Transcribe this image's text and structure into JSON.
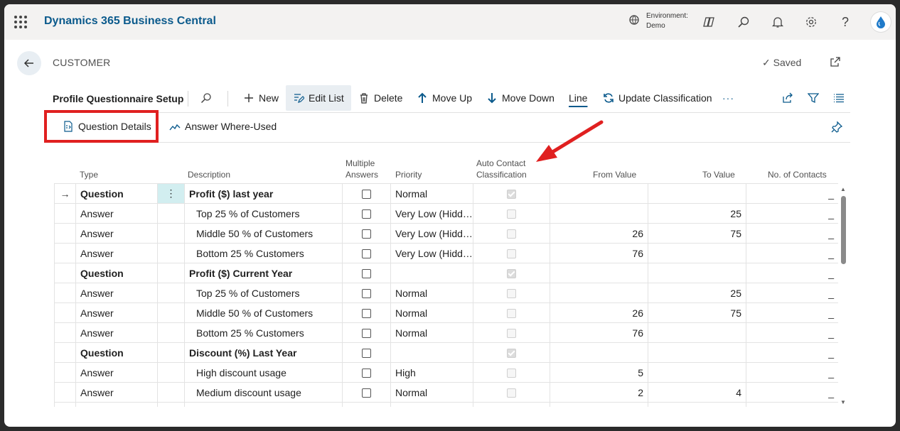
{
  "app": {
    "title": "Dynamics 365 Business Central",
    "environment_label": "Environment:",
    "environment_value": "Demo",
    "icons": [
      "waffle-icon",
      "environment-icon",
      "copilot-icon",
      "search-icon",
      "bell-icon",
      "gear-icon",
      "help-icon",
      "avatar"
    ]
  },
  "page": {
    "caption": "CUSTOMER",
    "saved_label": "Saved",
    "title": "Profile Questionnaire Setup"
  },
  "actions": {
    "new": "New",
    "edit_list": "Edit List",
    "delete": "Delete",
    "move_up": "Move Up",
    "move_down": "Move Down",
    "line": "Line",
    "update_classification": "Update Classification",
    "more": "···"
  },
  "promoted": {
    "question_details": "Question Details",
    "answer_where_used": "Answer Where-Used"
  },
  "columns": {
    "type": "Type",
    "description": "Description",
    "multiple_answers_1": "Multiple",
    "multiple_answers_2": "Answers",
    "priority": "Priority",
    "auto_contact_1": "Auto Contact",
    "auto_contact_2": "Classification",
    "from_value": "From Value",
    "to_value": "To Value",
    "no_of_contacts": "No. of Contacts"
  },
  "rows": [
    {
      "type": "Question",
      "description": "Profit ($) last year",
      "multiple": false,
      "priority": "Normal",
      "auto": true,
      "from": "",
      "to": "",
      "contacts": "_",
      "is_question": true,
      "current": true
    },
    {
      "type": "Answer",
      "description": "Top 25 % of Customers",
      "multiple": false,
      "priority": "Very Low (Hidd…",
      "auto": false,
      "from": "",
      "to": "25",
      "contacts": "_",
      "is_question": false
    },
    {
      "type": "Answer",
      "description": "Middle 50 % of Customers",
      "multiple": false,
      "priority": "Very Low (Hidd…",
      "auto": false,
      "from": "26",
      "to": "75",
      "contacts": "_",
      "is_question": false
    },
    {
      "type": "Answer",
      "description": "Bottom 25 % Customers",
      "multiple": false,
      "priority": "Very Low (Hidd…",
      "auto": false,
      "from": "76",
      "to": "",
      "contacts": "_",
      "is_question": false
    },
    {
      "type": "Question",
      "description": "Profit ($) Current Year",
      "multiple": false,
      "priority": "",
      "auto": true,
      "from": "",
      "to": "",
      "contacts": "_",
      "is_question": true
    },
    {
      "type": "Answer",
      "description": "Top 25 % of Customers",
      "multiple": false,
      "priority": "Normal",
      "auto": false,
      "from": "",
      "to": "25",
      "contacts": "_",
      "is_question": false
    },
    {
      "type": "Answer",
      "description": "Middle 50 % of Customers",
      "multiple": false,
      "priority": "Normal",
      "auto": false,
      "from": "26",
      "to": "75",
      "contacts": "_",
      "is_question": false
    },
    {
      "type": "Answer",
      "description": "Bottom 25 % Customers",
      "multiple": false,
      "priority": "Normal",
      "auto": false,
      "from": "76",
      "to": "",
      "contacts": "_",
      "is_question": false
    },
    {
      "type": "Question",
      "description": "Discount (%) Last Year",
      "multiple": false,
      "priority": "",
      "auto": true,
      "from": "",
      "to": "",
      "contacts": "_",
      "is_question": true
    },
    {
      "type": "Answer",
      "description": "High discount usage",
      "multiple": false,
      "priority": "High",
      "auto": false,
      "from": "5",
      "to": "",
      "contacts": "_",
      "is_question": false
    },
    {
      "type": "Answer",
      "description": "Medium discount usage",
      "multiple": false,
      "priority": "Normal",
      "auto": false,
      "from": "2",
      "to": "4",
      "contacts": "_",
      "is_question": false
    },
    {
      "type": "",
      "description": "",
      "multiple": false,
      "priority": "",
      "auto": false,
      "from": "",
      "to": "",
      "contacts": "",
      "is_question": false
    }
  ],
  "colors": {
    "brand": "#0b5a8c",
    "highlight_box": "#e02020",
    "selected_cell": "#d2eef0"
  }
}
